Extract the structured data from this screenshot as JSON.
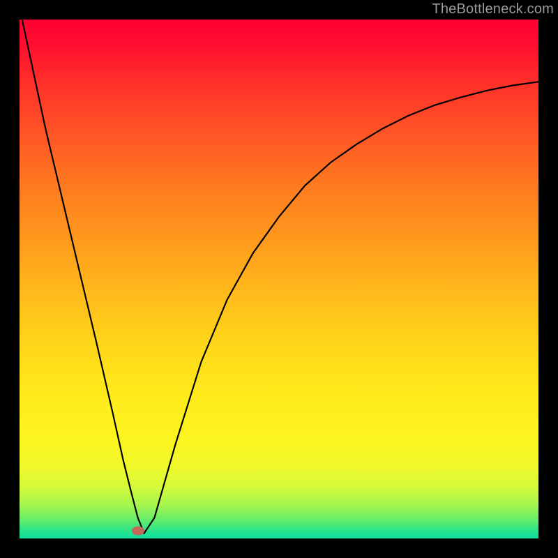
{
  "watermark": "TheBottleneck.com",
  "chart_data": {
    "type": "line",
    "title": "",
    "xlabel": "",
    "ylabel": "",
    "xlim": [
      0,
      100
    ],
    "ylim": [
      0,
      100
    ],
    "series": [
      {
        "name": "curve",
        "x": [
          0.5,
          5,
          10,
          15,
          18,
          20,
          21.5,
          22.8,
          24,
          26,
          30,
          35,
          40,
          45,
          50,
          55,
          60,
          65,
          70,
          75,
          80,
          85,
          90,
          95,
          100
        ],
        "values": [
          100,
          79,
          58,
          37,
          24,
          15,
          9,
          4,
          1,
          4,
          18,
          34,
          46,
          55,
          62,
          68,
          72.5,
          76,
          79,
          81.5,
          83.5,
          85,
          86.3,
          87.3,
          88
        ]
      }
    ],
    "marker": {
      "x": 22.8,
      "y": 1.5,
      "color": "#c16a5a"
    },
    "gradient_stops": [
      {
        "pos": 0,
        "color": "#ff0033"
      },
      {
        "pos": 0.5,
        "color": "#ffd51a"
      },
      {
        "pos": 0.86,
        "color": "#f1f92a"
      },
      {
        "pos": 1.0,
        "color": "#0fdfa0"
      }
    ]
  }
}
